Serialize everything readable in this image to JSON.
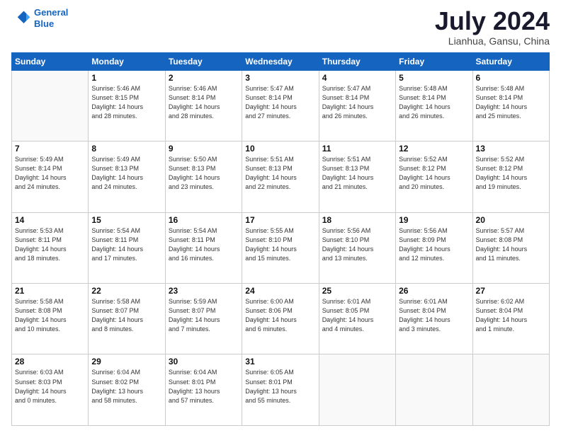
{
  "logo": {
    "line1": "General",
    "line2": "Blue"
  },
  "title": "July 2024",
  "subtitle": "Lianhua, Gansu, China",
  "headers": [
    "Sunday",
    "Monday",
    "Tuesday",
    "Wednesday",
    "Thursday",
    "Friday",
    "Saturday"
  ],
  "weeks": [
    [
      {
        "day": "",
        "info": ""
      },
      {
        "day": "1",
        "info": "Sunrise: 5:46 AM\nSunset: 8:15 PM\nDaylight: 14 hours\nand 28 minutes."
      },
      {
        "day": "2",
        "info": "Sunrise: 5:46 AM\nSunset: 8:14 PM\nDaylight: 14 hours\nand 28 minutes."
      },
      {
        "day": "3",
        "info": "Sunrise: 5:47 AM\nSunset: 8:14 PM\nDaylight: 14 hours\nand 27 minutes."
      },
      {
        "day": "4",
        "info": "Sunrise: 5:47 AM\nSunset: 8:14 PM\nDaylight: 14 hours\nand 26 minutes."
      },
      {
        "day": "5",
        "info": "Sunrise: 5:48 AM\nSunset: 8:14 PM\nDaylight: 14 hours\nand 26 minutes."
      },
      {
        "day": "6",
        "info": "Sunrise: 5:48 AM\nSunset: 8:14 PM\nDaylight: 14 hours\nand 25 minutes."
      }
    ],
    [
      {
        "day": "7",
        "info": "Sunrise: 5:49 AM\nSunset: 8:14 PM\nDaylight: 14 hours\nand 24 minutes."
      },
      {
        "day": "8",
        "info": "Sunrise: 5:49 AM\nSunset: 8:13 PM\nDaylight: 14 hours\nand 24 minutes."
      },
      {
        "day": "9",
        "info": "Sunrise: 5:50 AM\nSunset: 8:13 PM\nDaylight: 14 hours\nand 23 minutes."
      },
      {
        "day": "10",
        "info": "Sunrise: 5:51 AM\nSunset: 8:13 PM\nDaylight: 14 hours\nand 22 minutes."
      },
      {
        "day": "11",
        "info": "Sunrise: 5:51 AM\nSunset: 8:13 PM\nDaylight: 14 hours\nand 21 minutes."
      },
      {
        "day": "12",
        "info": "Sunrise: 5:52 AM\nSunset: 8:12 PM\nDaylight: 14 hours\nand 20 minutes."
      },
      {
        "day": "13",
        "info": "Sunrise: 5:52 AM\nSunset: 8:12 PM\nDaylight: 14 hours\nand 19 minutes."
      }
    ],
    [
      {
        "day": "14",
        "info": "Sunrise: 5:53 AM\nSunset: 8:11 PM\nDaylight: 14 hours\nand 18 minutes."
      },
      {
        "day": "15",
        "info": "Sunrise: 5:54 AM\nSunset: 8:11 PM\nDaylight: 14 hours\nand 17 minutes."
      },
      {
        "day": "16",
        "info": "Sunrise: 5:54 AM\nSunset: 8:11 PM\nDaylight: 14 hours\nand 16 minutes."
      },
      {
        "day": "17",
        "info": "Sunrise: 5:55 AM\nSunset: 8:10 PM\nDaylight: 14 hours\nand 15 minutes."
      },
      {
        "day": "18",
        "info": "Sunrise: 5:56 AM\nSunset: 8:10 PM\nDaylight: 14 hours\nand 13 minutes."
      },
      {
        "day": "19",
        "info": "Sunrise: 5:56 AM\nSunset: 8:09 PM\nDaylight: 14 hours\nand 12 minutes."
      },
      {
        "day": "20",
        "info": "Sunrise: 5:57 AM\nSunset: 8:08 PM\nDaylight: 14 hours\nand 11 minutes."
      }
    ],
    [
      {
        "day": "21",
        "info": "Sunrise: 5:58 AM\nSunset: 8:08 PM\nDaylight: 14 hours\nand 10 minutes."
      },
      {
        "day": "22",
        "info": "Sunrise: 5:58 AM\nSunset: 8:07 PM\nDaylight: 14 hours\nand 8 minutes."
      },
      {
        "day": "23",
        "info": "Sunrise: 5:59 AM\nSunset: 8:07 PM\nDaylight: 14 hours\nand 7 minutes."
      },
      {
        "day": "24",
        "info": "Sunrise: 6:00 AM\nSunset: 8:06 PM\nDaylight: 14 hours\nand 6 minutes."
      },
      {
        "day": "25",
        "info": "Sunrise: 6:01 AM\nSunset: 8:05 PM\nDaylight: 14 hours\nand 4 minutes."
      },
      {
        "day": "26",
        "info": "Sunrise: 6:01 AM\nSunset: 8:04 PM\nDaylight: 14 hours\nand 3 minutes."
      },
      {
        "day": "27",
        "info": "Sunrise: 6:02 AM\nSunset: 8:04 PM\nDaylight: 14 hours\nand 1 minute."
      }
    ],
    [
      {
        "day": "28",
        "info": "Sunrise: 6:03 AM\nSunset: 8:03 PM\nDaylight: 14 hours\nand 0 minutes."
      },
      {
        "day": "29",
        "info": "Sunrise: 6:04 AM\nSunset: 8:02 PM\nDaylight: 13 hours\nand 58 minutes."
      },
      {
        "day": "30",
        "info": "Sunrise: 6:04 AM\nSunset: 8:01 PM\nDaylight: 13 hours\nand 57 minutes."
      },
      {
        "day": "31",
        "info": "Sunrise: 6:05 AM\nSunset: 8:01 PM\nDaylight: 13 hours\nand 55 minutes."
      },
      {
        "day": "",
        "info": ""
      },
      {
        "day": "",
        "info": ""
      },
      {
        "day": "",
        "info": ""
      }
    ]
  ]
}
